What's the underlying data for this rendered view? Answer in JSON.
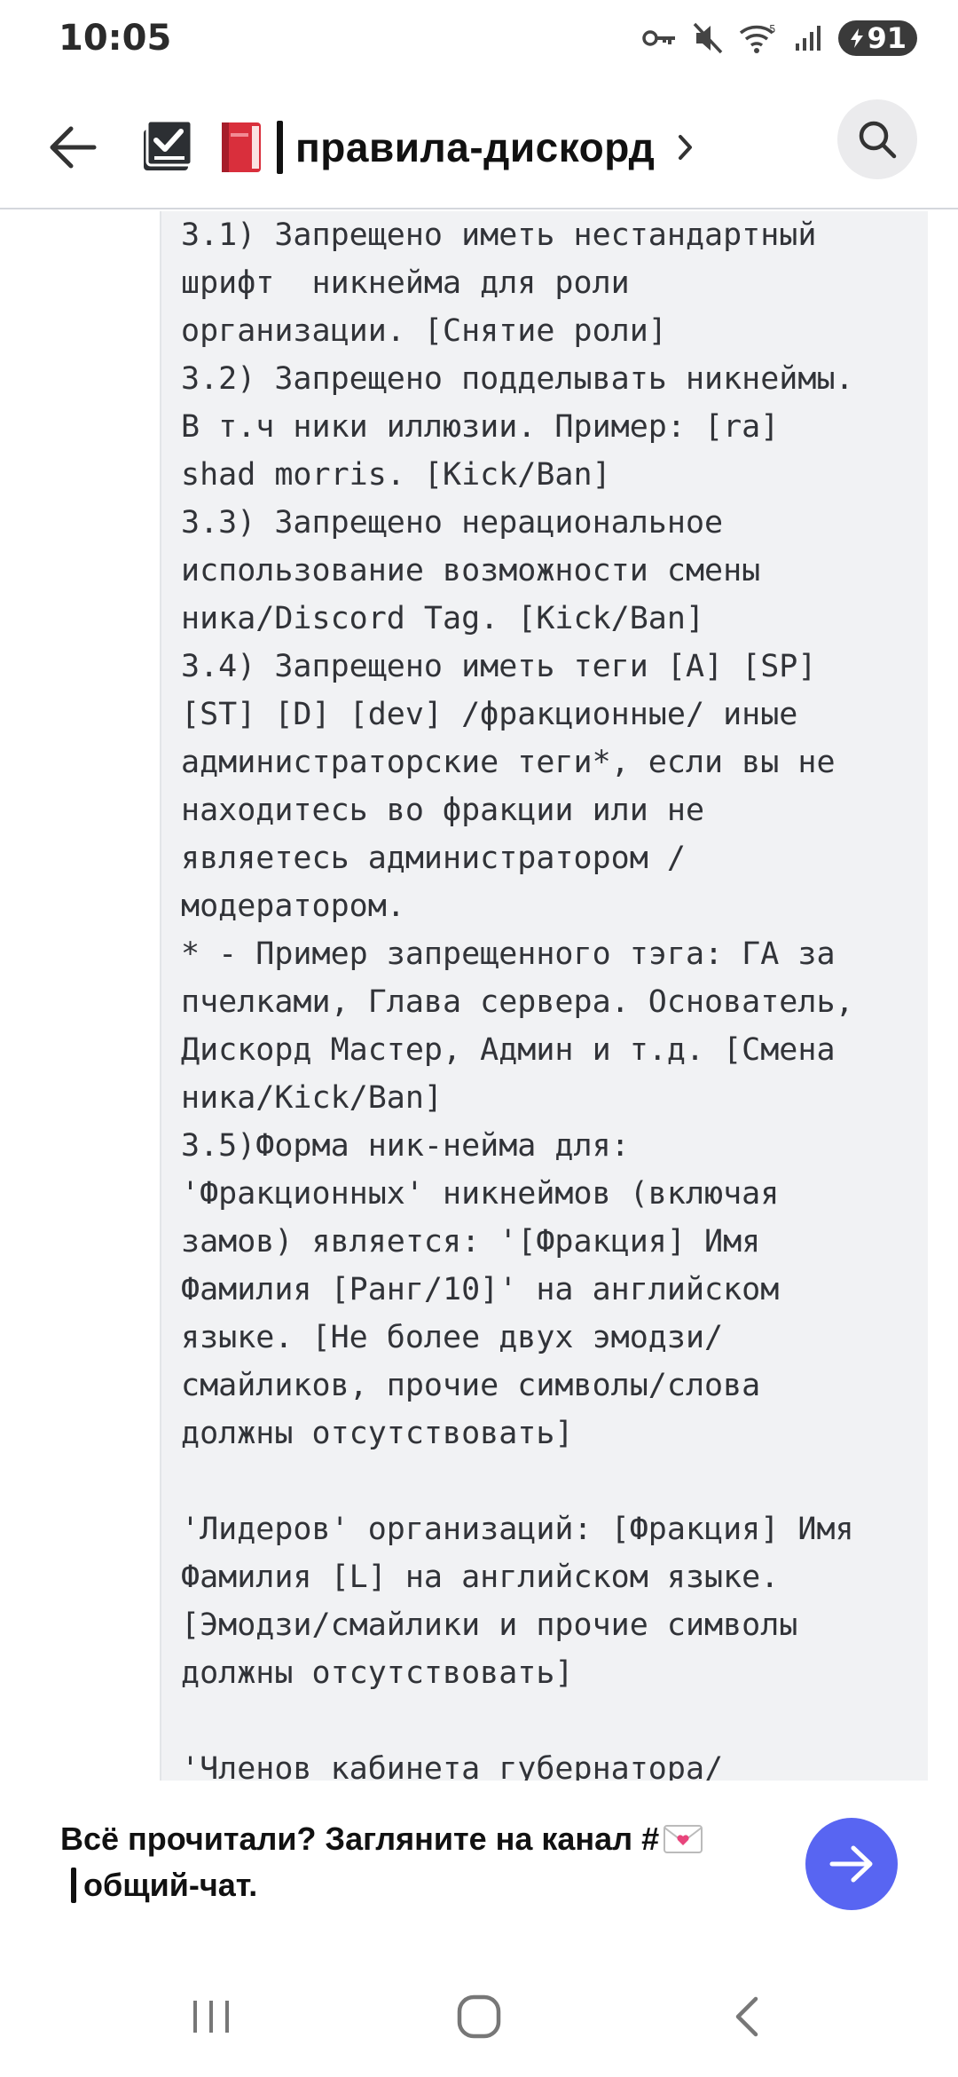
{
  "status_bar": {
    "time": "10:05",
    "battery": "91",
    "icons": [
      "key-icon",
      "mute-icon",
      "wifi-icon",
      "signal-icon",
      "battery-icon"
    ]
  },
  "header": {
    "back_icon": "arrow-left-icon",
    "channel_icon": "rules-channel-icon",
    "title": "правила-дискорд",
    "title_emoji": "red-book-emoji",
    "chevron_icon": "chevron-right-icon",
    "search_icon": "search-icon"
  },
  "content": {
    "code_lines": [
      "3.1) Запрещено иметь нестандартный",
      "шрифт  никнейма для роли",
      "организации. [Снятие роли]",
      "3.2) Запрещено подделывать никнеймы.",
      "В т.ч ники иллюзии. Пример: [ra]",
      "shad morris. [Kick/Ban]",
      "3.3) Запрещено нерациональное",
      "использование возможности смены",
      "ника/Discord Tag. [Kick/Ban]",
      "3.4) Запрещено иметь теги [A] [SP]",
      "[ST] [D] [dev] /фракционные/ иные",
      "администраторские теги*, если вы не",
      "находитесь во фракции или не",
      "являетесь администратором /",
      "модератором.",
      "* - Пример запрещенного тэга: ГА за",
      "пчелками, Глава сервера. Основатель,",
      "Дискорд Мастер, Админ и т.д. [Смена",
      "ника/Kick/Ban]",
      "3.5)Форма ник-нейма для:",
      "'Фракционных' никнеймов (включая",
      "замов) является: '[Фракция] Имя",
      "Фамилия [Ранг/10]' на английском",
      "языке. [Не более двух эмодзи/",
      "смайликов, прочие символы/слова",
      "должны отсутствовать]",
      "",
      "'Лидеров' организаций: [Фракция] Имя",
      "Фамилия [L] на английском языке.",
      "[Эмодзи/смайлики и прочие символы",
      "должны отсутствовать]",
      "",
      "'Членов кабинета губернатора/"
    ]
  },
  "footer": {
    "message_part1": "Всё прочитали? Загляните на канал #",
    "message_part2": "общий-чат.",
    "emoji": "love-letter-emoji",
    "send_icon": "arrow-right-icon"
  },
  "navbar": {
    "items": [
      "recents-icon",
      "home-icon",
      "back-icon"
    ]
  },
  "colors": {
    "accent": "#5865f2",
    "code_bg": "#f1f2f4",
    "code_text": "#313338"
  }
}
